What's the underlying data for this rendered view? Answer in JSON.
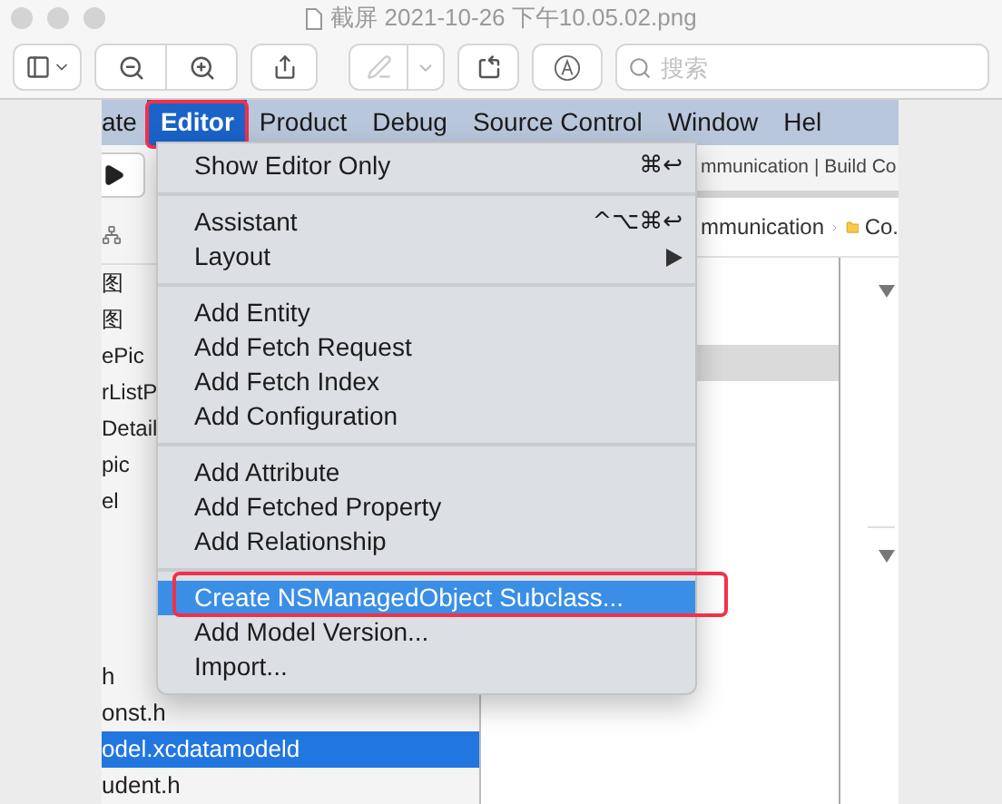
{
  "window": {
    "title": "截屏 2021-10-26 下午10.05.02.png"
  },
  "toolbar": {
    "search": {
      "placeholder": "搜索"
    }
  },
  "screenshot": {
    "menu_bar": [
      {
        "label": "ate",
        "selected": false,
        "annotated": false
      },
      {
        "label": "Editor",
        "selected": true,
        "annotated": true
      },
      {
        "label": "Product",
        "selected": false,
        "annotated": false
      },
      {
        "label": "Debug",
        "selected": false,
        "annotated": false
      },
      {
        "label": "Source Control",
        "selected": false,
        "annotated": false
      },
      {
        "label": "Window",
        "selected": false,
        "annotated": false
      },
      {
        "label": "Hel",
        "selected": false,
        "annotated": false
      }
    ],
    "editor_menu": [
      {
        "kind": "item",
        "label": "Show Editor Only",
        "shortcut": "⌘↩",
        "selected": false,
        "annotated": false
      },
      {
        "kind": "separator"
      },
      {
        "kind": "item",
        "label": "Assistant",
        "shortcut": "^⌥⌘↩",
        "selected": false,
        "annotated": false
      },
      {
        "kind": "submenu",
        "label": "Layout",
        "selected": false,
        "annotated": false
      },
      {
        "kind": "separator"
      },
      {
        "kind": "item",
        "label": "Add Entity",
        "selected": false,
        "annotated": false
      },
      {
        "kind": "item",
        "label": "Add Fetch Request",
        "selected": false,
        "annotated": false
      },
      {
        "kind": "item",
        "label": "Add Fetch Index",
        "selected": false,
        "annotated": false
      },
      {
        "kind": "item",
        "label": "Add Configuration",
        "selected": false,
        "annotated": false
      },
      {
        "kind": "separator"
      },
      {
        "kind": "item",
        "label": "Add Attribute",
        "selected": false,
        "annotated": false
      },
      {
        "kind": "item",
        "label": "Add Fetched Property",
        "selected": false,
        "annotated": false
      },
      {
        "kind": "item",
        "label": "Add Relationship",
        "selected": false,
        "annotated": false
      },
      {
        "kind": "separator"
      },
      {
        "kind": "item",
        "label": "Create NSManagedObject Subclass...",
        "selected": true,
        "annotated": true
      },
      {
        "kind": "item",
        "label": "Add Model Version...",
        "selected": false,
        "annotated": false
      },
      {
        "kind": "item",
        "label": "Import...",
        "selected": false,
        "annotated": false
      }
    ],
    "navigator_upper": [
      {
        "label": "图",
        "selected": false
      },
      {
        "label": "图",
        "selected": false
      },
      {
        "label": "ePic",
        "selected": false
      },
      {
        "label": "rListP",
        "selected": false
      },
      {
        "label": "Detail",
        "selected": false
      },
      {
        "label": "pic",
        "selected": false
      },
      {
        "label": "el",
        "selected": false
      }
    ],
    "navigator_lower": [
      {
        "label": "h",
        "selected": false
      },
      {
        "label": "onst.h",
        "selected": false
      },
      {
        "label": "odel.xcdatamodeld",
        "selected": true
      },
      {
        "label": "udent.h",
        "selected": false
      }
    ],
    "activity": "mmunication | Build Co",
    "breadcrumb": {
      "segment": "mmunication",
      "folder": "Co."
    }
  }
}
